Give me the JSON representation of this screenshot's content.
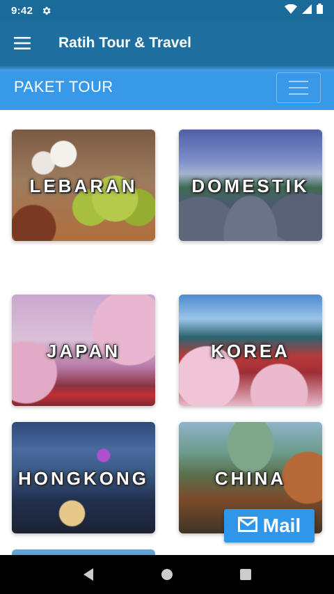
{
  "status_bar": {
    "time": "9:42",
    "icons": [
      "gear-icon",
      "wifi-icon",
      "signal-icon",
      "battery-icon"
    ]
  },
  "app_bar": {
    "menu_icon": "hamburger-menu-icon",
    "title": "Ratih Tour & Travel",
    "background": "#1e6f9f"
  },
  "section": {
    "title": "PAKET TOUR",
    "toggler_icon": "hamburger-toggler-icon",
    "background": "#3899e8"
  },
  "tour_cards": [
    {
      "label": "LEBARAN"
    },
    {
      "label": "DOMESTIK"
    },
    {
      "label": "JAPAN"
    },
    {
      "label": "KOREA"
    },
    {
      "label": "HONGKONG"
    },
    {
      "label": "CHINA"
    }
  ],
  "mail_button": {
    "icon": "mail-icon",
    "label": "Mail",
    "color": "#2f96e8"
  },
  "nav_bar": {
    "items": [
      "back-icon",
      "home-icon",
      "recents-icon"
    ]
  }
}
